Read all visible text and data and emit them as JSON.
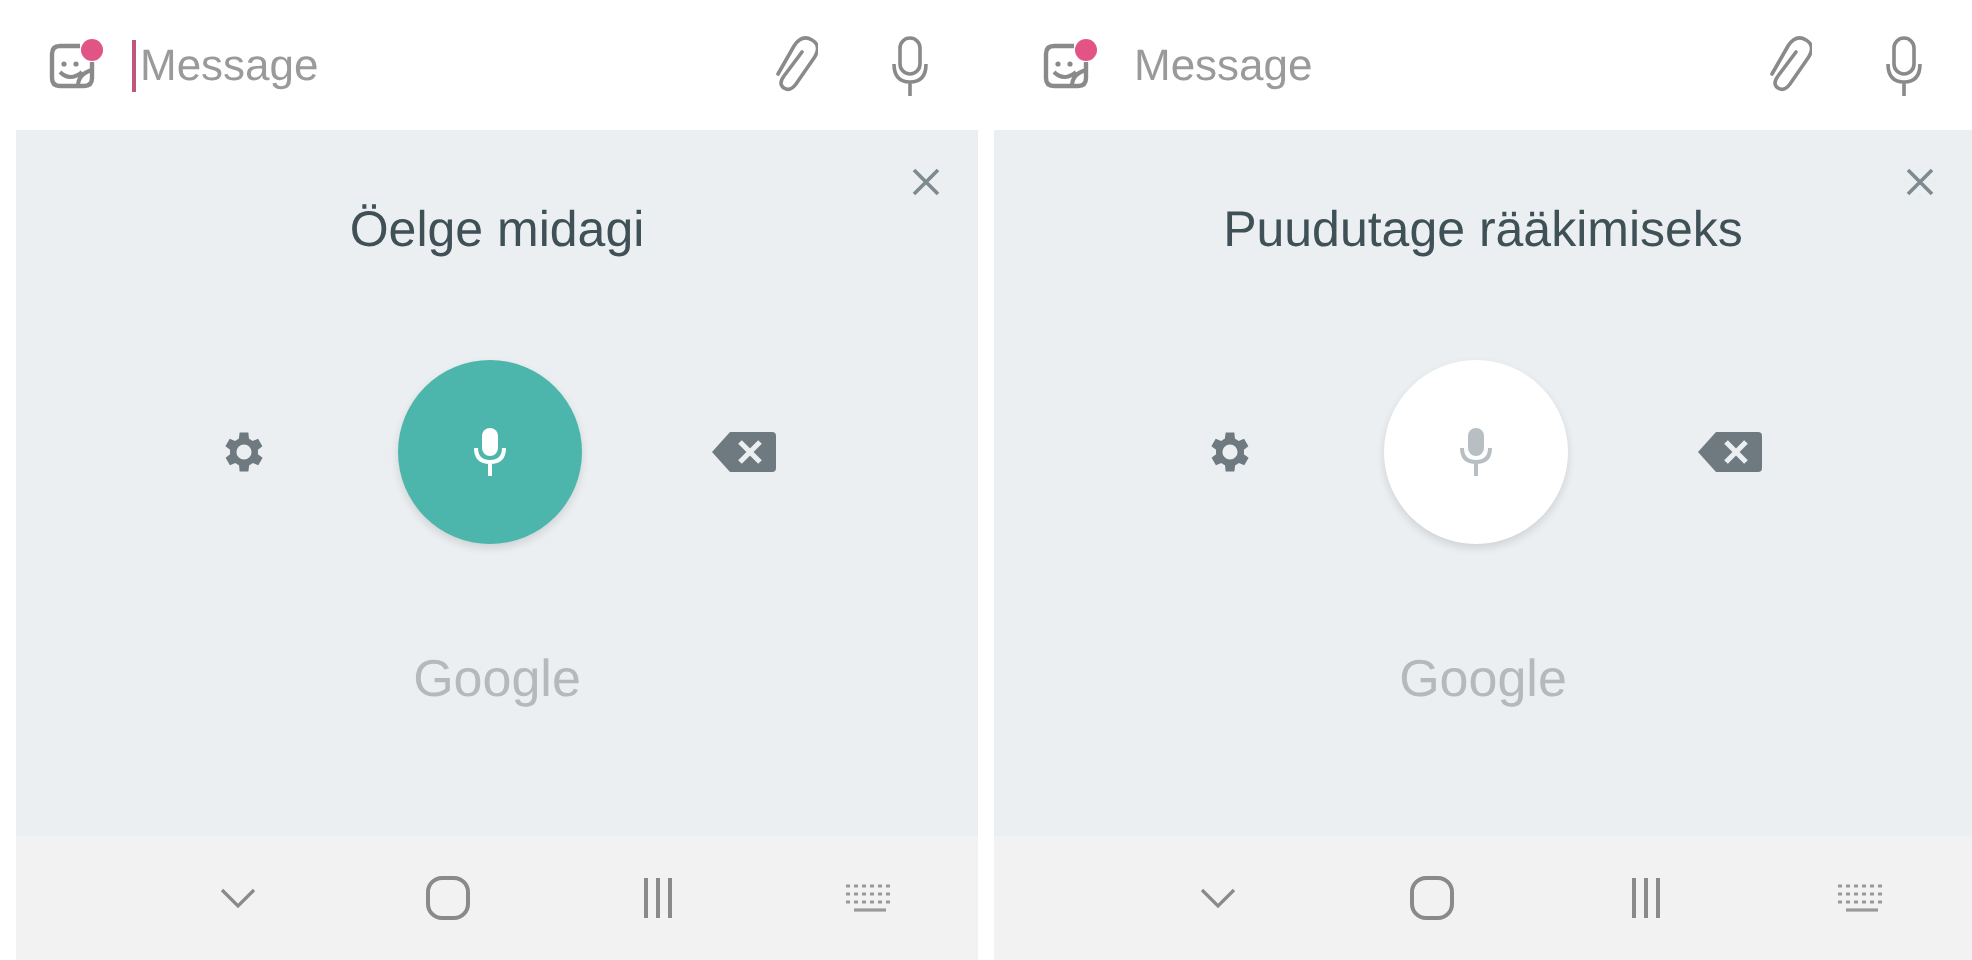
{
  "screens": [
    {
      "message": {
        "placeholder": "Message",
        "focused": true
      },
      "prompt": "Öelge midagi",
      "listening": true,
      "logo": "Google"
    },
    {
      "message": {
        "placeholder": "Message",
        "focused": false
      },
      "prompt": "Puudutage rääkimiseks",
      "listening": false,
      "logo": "Google"
    }
  ]
}
